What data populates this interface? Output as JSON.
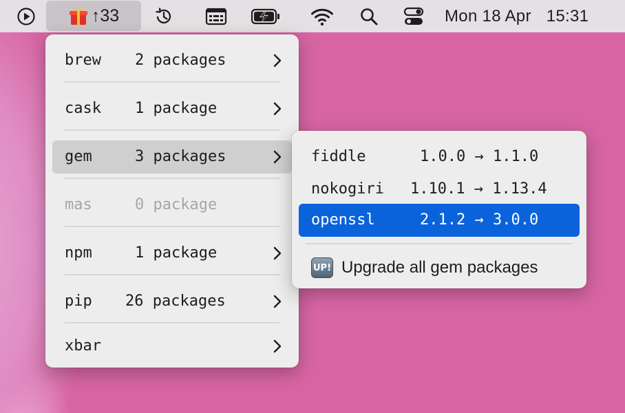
{
  "menubar": {
    "app_count": "↑33",
    "clock": {
      "date": "Mon 18 Apr",
      "time": "15:31"
    },
    "icons": [
      "play-circle-icon",
      "gift-icon",
      "time-machine-icon",
      "keyboard-viewer-icon",
      "battery-charging-icon",
      "wifi-icon",
      "search-icon",
      "control-center-icon"
    ]
  },
  "main_menu": {
    "items": [
      {
        "name": "brew",
        "count": "2 package",
        "suffix": "s"
      },
      {
        "name": "cask",
        "count": "1 package",
        "suffix": ""
      },
      {
        "name": "gem",
        "count": "3 package",
        "suffix": "s"
      },
      {
        "name": "mas",
        "count": "0 package",
        "suffix": ""
      },
      {
        "name": "npm",
        "count": "1 package",
        "suffix": ""
      },
      {
        "name": "pip",
        "count": "26 package",
        "suffix": "s"
      },
      {
        "name": "xbar",
        "count": "",
        "suffix": ""
      }
    ],
    "highlighted": "gem",
    "disabled": "mas"
  },
  "submenu": {
    "packages": [
      {
        "name": "fiddle",
        "versions": "1.0.0 → 1.1.0"
      },
      {
        "name": "nokogiri",
        "versions": "1.10.1 → 1.13.4"
      },
      {
        "name": "openssl",
        "versions": "2.1.2 → 3.0.0"
      }
    ],
    "selected": "openssl",
    "upgrade_icon_text": "UP!",
    "upgrade_all_label": "Upgrade all gem packages"
  },
  "colors": {
    "selection": "#0a63db",
    "hover": "#cfcfcf",
    "wallpaper": "#d765a3",
    "menubar": "#e5e0e3"
  }
}
